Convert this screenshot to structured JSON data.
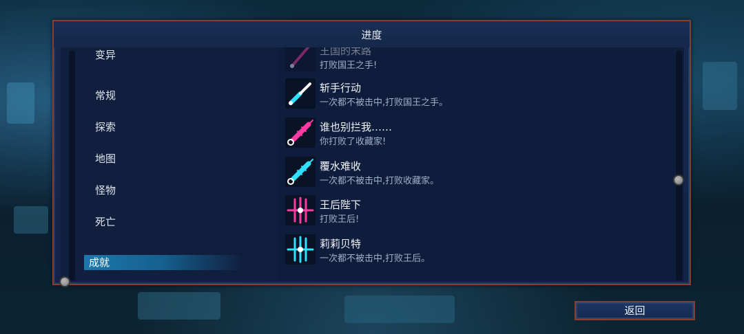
{
  "panel": {
    "title": "进度"
  },
  "categories": [
    {
      "label": "变异",
      "active": false
    },
    {
      "label": "常规",
      "active": false
    },
    {
      "label": "探索",
      "active": false
    },
    {
      "label": "地图",
      "active": false
    },
    {
      "label": "怪物",
      "active": false
    },
    {
      "label": "死亡",
      "active": false
    },
    {
      "label": "成就",
      "active": true
    }
  ],
  "achievements": [
    {
      "title": "王国的末路",
      "desc": "打败国王之手!",
      "icon": "sword-icon-magenta",
      "color": "#ff3aa0"
    },
    {
      "title": "斩手行动",
      "desc": "一次都不被击中,打败国王之手。",
      "icon": "sword-icon-cyan",
      "color": "#2fe0ff"
    },
    {
      "title": "谁也别拦我……",
      "desc": "你打败了收藏家!",
      "icon": "syringe-icon-magenta",
      "color": "#ff3aa0"
    },
    {
      "title": "覆水难收",
      "desc": "一次都不被击中,打败收藏家。",
      "icon": "syringe-icon-cyan",
      "color": "#2fe0ff"
    },
    {
      "title": "王后陛下",
      "desc": "打败王后!",
      "icon": "crown-spikes-icon-magenta",
      "color": "#ff3aa0"
    },
    {
      "title": "莉莉贝特",
      "desc": "一次都不被击中,打败王后。",
      "icon": "crown-spikes-icon-cyan",
      "color": "#2fe0ff"
    }
  ],
  "back_button": {
    "label": "返回"
  }
}
